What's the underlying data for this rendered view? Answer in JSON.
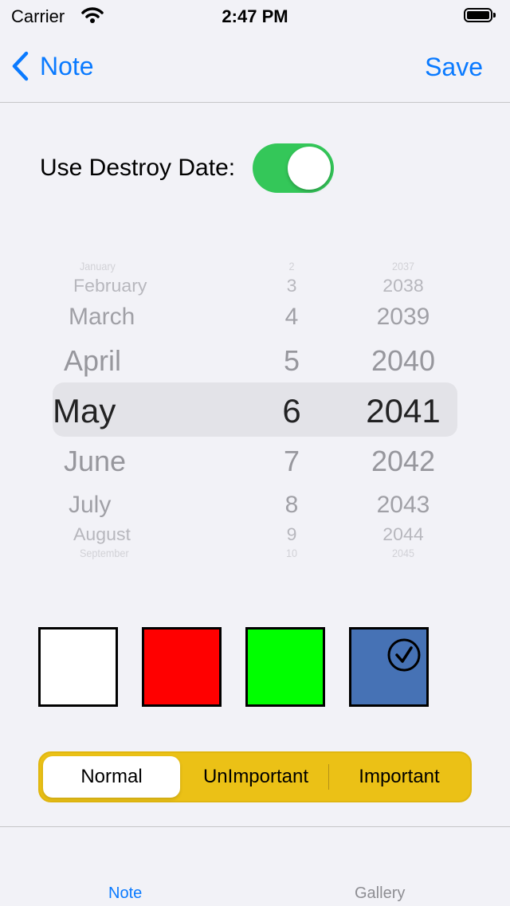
{
  "status_bar": {
    "carrier": "Carrier",
    "time": "2:47 PM"
  },
  "nav": {
    "back_label": "Note",
    "save_label": "Save"
  },
  "destroy_date": {
    "label": "Use Destroy Date:",
    "enabled": true
  },
  "picker": {
    "months": [
      "January",
      "February",
      "March",
      "April",
      "May",
      "June",
      "July",
      "August",
      "September"
    ],
    "days": [
      "2",
      "3",
      "4",
      "5",
      "6",
      "7",
      "8",
      "9",
      "10"
    ],
    "years": [
      "2037",
      "2038",
      "2039",
      "2040",
      "2041",
      "2042",
      "2043",
      "2044",
      "2045"
    ],
    "selected": {
      "month": "May",
      "day": "6",
      "year": "2041"
    }
  },
  "colors": {
    "swatches": [
      "#ffffff",
      "#ff0000",
      "#00ff00",
      "#4672b5"
    ],
    "selected_index": 3
  },
  "importance": {
    "options": [
      "Normal",
      "UnImportant",
      "Important"
    ],
    "selected": "Normal"
  },
  "tabs": [
    {
      "label": "Note",
      "active": true
    },
    {
      "label": "Gallery",
      "active": false
    }
  ],
  "theme": {
    "accent": "#0a7aff",
    "toggle_on": "#34c759",
    "segment_bg": "#ebc116"
  }
}
